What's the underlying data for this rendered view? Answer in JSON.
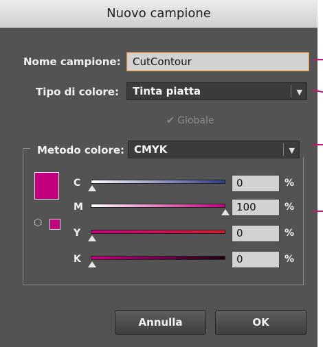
{
  "window": {
    "title": "Nuovo campione"
  },
  "fields": {
    "name_label": "Nome campione:",
    "name_value": "CutContour",
    "type_label": "Tipo di colore:",
    "type_value": "Tinta piatta",
    "global_label": "Globale",
    "global_checked": true,
    "method_label": "Metodo colore:",
    "method_value": "CMYK"
  },
  "channels": [
    {
      "label": "C",
      "value": "0",
      "unit": "%",
      "level": 0,
      "gradient_start": "#ffffff",
      "gradient_end": "#2f3b8c"
    },
    {
      "label": "M",
      "value": "100",
      "unit": "%",
      "level": 100,
      "gradient_start": "#ffffff",
      "gradient_end": "#c2007d"
    },
    {
      "label": "Y",
      "value": "0",
      "unit": "%",
      "level": 0,
      "gradient_start": "#c2007d",
      "gradient_end": "#d41e2c"
    },
    {
      "label": "K",
      "value": "0",
      "unit": "%",
      "level": 0,
      "gradient_start": "#c2007d",
      "gradient_end": "#1a0010"
    }
  ],
  "swatch_color": "#c2007d",
  "icons": {
    "dropdown_arrow": "chevron-down-icon",
    "check": "checkmark-icon",
    "out_of_gamut": "cube-icon"
  },
  "buttons": {
    "cancel": "Annulla",
    "ok": "OK"
  }
}
